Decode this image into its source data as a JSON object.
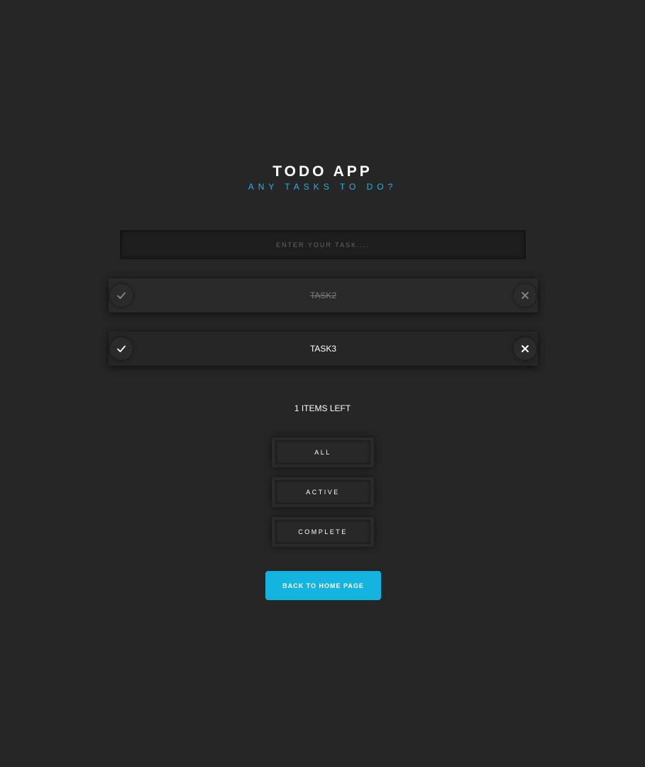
{
  "header": {
    "title": "TODO APP",
    "subtitle": "ANY TASKS TO DO?"
  },
  "input": {
    "placeholder": "ENTER YOUR TASK....",
    "value": ""
  },
  "todos": [
    {
      "text": "TASK2",
      "completed": true,
      "check_icon": "check-icon",
      "delete_icon": "close-icon"
    },
    {
      "text": "TASK3",
      "completed": false,
      "check_icon": "check-icon",
      "delete_icon": "close-icon"
    }
  ],
  "footer": {
    "items_left": "1 ITEMS LEFT"
  },
  "filters": {
    "all": "ALL",
    "active": "ACTIVE",
    "complete": "COMPLETE"
  },
  "home_button": {
    "label": "BACK TO HOME PAGE"
  },
  "colors": {
    "background": "#262626",
    "accent": "#14b4e0",
    "subtitle": "#1fb5e0",
    "completed_text": "#7a7a7a"
  }
}
